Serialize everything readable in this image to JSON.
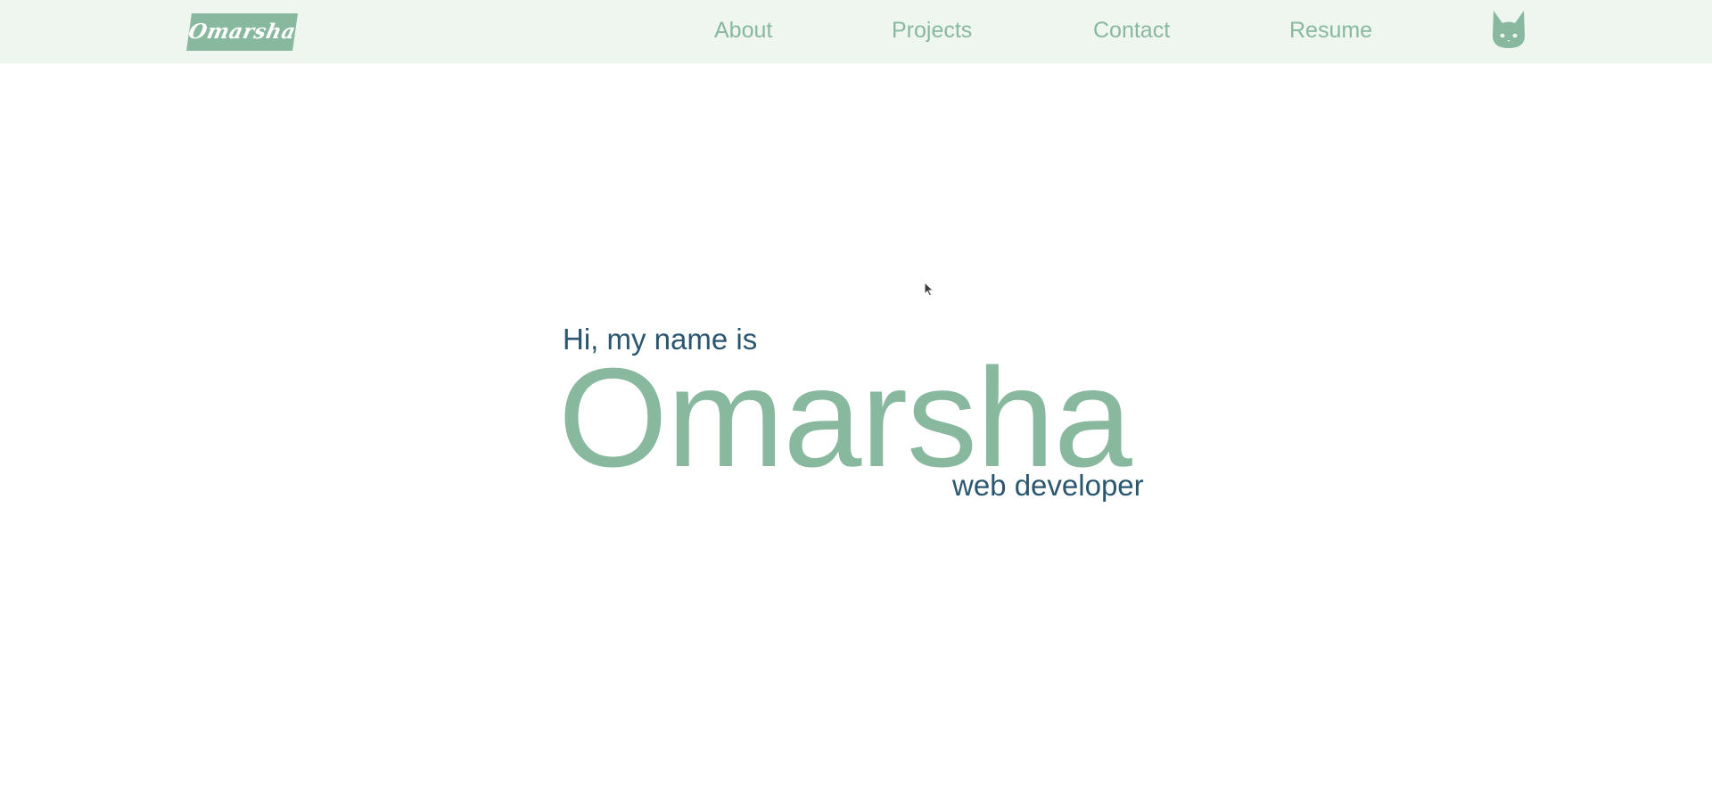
{
  "navbar": {
    "logo": {
      "text": "Omarsha",
      "color": "#88b89e"
    },
    "links": [
      {
        "label": "About"
      },
      {
        "label": "Projects"
      },
      {
        "label": "Contact"
      },
      {
        "label": "Resume"
      }
    ],
    "cat_icon": "cat-head-icon",
    "background": "#eff5ef",
    "link_color": "#88b89e"
  },
  "hero": {
    "greeting": "Hi, my name is",
    "name": "Omarsha",
    "role": "web developer",
    "accent_color": "#88b89e",
    "text_color": "#2a5670"
  }
}
